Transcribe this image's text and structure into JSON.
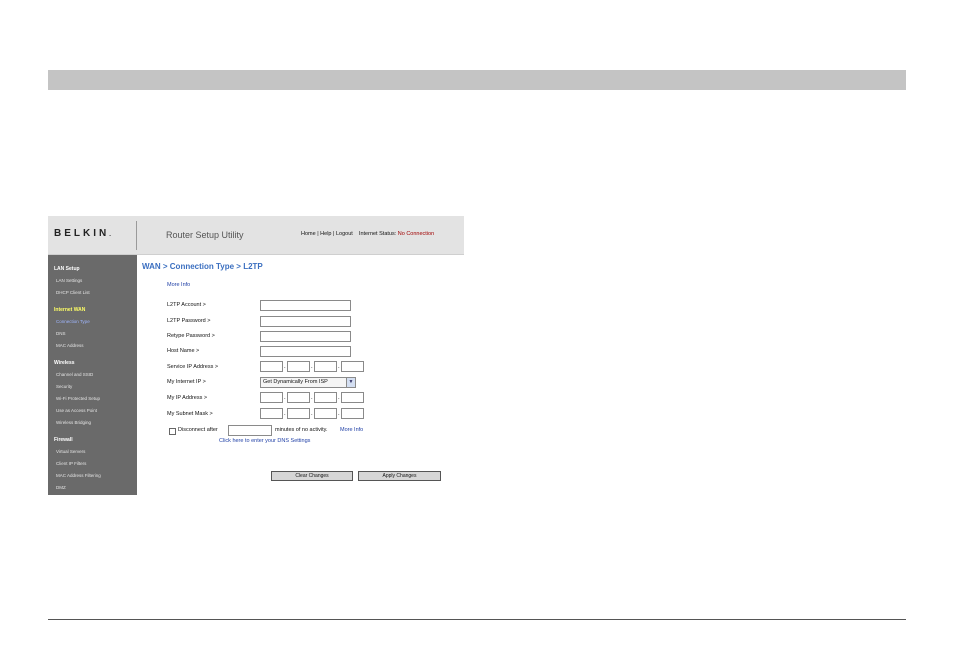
{
  "header": {
    "logo": "BELKIN",
    "logo_mark": ".",
    "app_title": "Router Setup Utility",
    "links": [
      "Home",
      "Help",
      "Logout"
    ],
    "separator": "|",
    "status_label": "Internet Status:",
    "status_value": "No Connection",
    "colors": {
      "status": "#a00000",
      "header_bg": "#e3e3e3"
    }
  },
  "sidebar": {
    "colors": {
      "bg": "#6a6a6a",
      "active_section": "#ffff66",
      "current_item": "#9fb6ff"
    },
    "sections": [
      {
        "title": "LAN Setup",
        "items": [
          "LAN Settings",
          "DHCP Client List"
        ]
      },
      {
        "title": "Internet WAN",
        "items": [
          "Connection Type",
          "DNS",
          "MAC Address"
        ]
      },
      {
        "title": "Wireless",
        "items": [
          "Channel and SSID",
          "Security",
          "Wi-Fi Protected Setup",
          "Use as Access Point",
          "Wireless Bridging"
        ]
      },
      {
        "title": "Firewall",
        "items": [
          "Virtual Servers",
          "Client IP Filters",
          "MAC Address Filtering",
          "DMZ"
        ]
      }
    ]
  },
  "main": {
    "title": "WAN > Connection Type > L2TP",
    "more_info": "More Info",
    "fields": {
      "account": {
        "label": "L2TP Account >",
        "value": ""
      },
      "password": {
        "label": "L2TP Password >",
        "value": ""
      },
      "retype": {
        "label": "Retype Password >",
        "value": ""
      },
      "host": {
        "label": "Host Name >",
        "value": ""
      },
      "service_ip": {
        "label": "Service IP Address >",
        "octets": [
          "",
          "",
          "",
          ""
        ]
      },
      "internet_ip": {
        "label": "My Internet IP >",
        "selected": "Get Dynamically From ISP"
      },
      "my_ip": {
        "label": "My IP Address >",
        "octets": [
          "",
          "",
          "",
          ""
        ]
      },
      "subnet": {
        "label": "My Subnet Mask >",
        "octets": [
          "",
          "",
          "",
          ""
        ]
      }
    },
    "octet_dot": ".",
    "disconnect": {
      "checked": false,
      "label": "Disconnect after",
      "minutes_value": "",
      "suffix": "minutes of no activity.",
      "more_info": "More Info"
    },
    "dns_link": "Click here to enter your DNS Settings",
    "buttons": {
      "clear": "Clear Changes",
      "apply": "Apply Changes"
    }
  },
  "page": {
    "colors": {
      "bar": "#c4c4c4",
      "link": "#1f3fa6",
      "title": "#3b6fc0"
    }
  }
}
